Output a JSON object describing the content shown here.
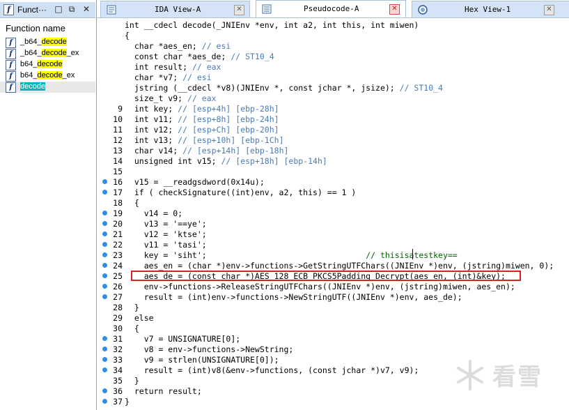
{
  "functions_pane": {
    "title": "Funct···",
    "header": "Function name",
    "items": [
      {
        "prefix": "_b64_",
        "match": "decode",
        "suffix": ""
      },
      {
        "prefix": "_b64_",
        "match": "decode",
        "suffix": "_ex"
      },
      {
        "prefix": "b64_",
        "match": "decode",
        "suffix": ""
      },
      {
        "prefix": "b64_",
        "match": "decode",
        "suffix": "_ex"
      },
      {
        "prefix": "",
        "match": "decode",
        "suffix": ""
      }
    ]
  },
  "tabs": [
    {
      "label": "IDA View-A",
      "icon": "ida-view-icon",
      "active": false
    },
    {
      "label": "Pseudocode-A",
      "icon": "pseudocode-icon",
      "active": true
    },
    {
      "label": "Hex View-1",
      "icon": "hex-view-icon",
      "active": false
    }
  ],
  "code_lines": [
    {
      "num": "",
      "dot": false,
      "text": "int __cdecl decode(_JNIEnv *env, int a2, int this, int miwen)"
    },
    {
      "num": "",
      "dot": false,
      "text": "{"
    },
    {
      "num": "",
      "dot": false,
      "text": "  char *aes_en; // esi"
    },
    {
      "num": "",
      "dot": false,
      "text": "  const char *aes_de; // ST10_4"
    },
    {
      "num": "",
      "dot": false,
      "text": "  int result; // eax"
    },
    {
      "num": "",
      "dot": false,
      "text": "  char *v7; // esi"
    },
    {
      "num": "",
      "dot": false,
      "text": "  jstring (__cdecl *v8)(JNIEnv *, const jchar *, jsize); // ST10_4"
    },
    {
      "num": "",
      "dot": false,
      "text": "  size_t v9; // eax"
    },
    {
      "num": "9",
      "dot": false,
      "text": "  int key; // [esp+4h] [ebp-28h]"
    },
    {
      "num": "10",
      "dot": false,
      "text": "  int v11; // [esp+8h] [ebp-24h]"
    },
    {
      "num": "11",
      "dot": false,
      "text": "  int v12; // [esp+Ch] [ebp-20h]"
    },
    {
      "num": "12",
      "dot": false,
      "text": "  int v13; // [esp+10h] [ebp-1Ch]"
    },
    {
      "num": "13",
      "dot": false,
      "text": "  char v14; // [esp+14h] [ebp-18h]"
    },
    {
      "num": "14",
      "dot": false,
      "text": "  unsigned int v15; // [esp+18h] [ebp-14h]"
    },
    {
      "num": "15",
      "dot": false,
      "text": ""
    },
    {
      "num": "16",
      "dot": true,
      "text": "  v15 = __readgsdword(0x14u);"
    },
    {
      "num": "17",
      "dot": true,
      "text": "  if ( checkSignature((int)env, a2, this) == 1 )"
    },
    {
      "num": "18",
      "dot": false,
      "text": "  {"
    },
    {
      "num": "19",
      "dot": true,
      "text": "    v14 = 0;"
    },
    {
      "num": "20",
      "dot": true,
      "text": "    v13 = '==ye';"
    },
    {
      "num": "21",
      "dot": true,
      "text": "    v12 = 'ktse';"
    },
    {
      "num": "22",
      "dot": true,
      "text": "    v11 = 'tasi';"
    },
    {
      "num": "23",
      "dot": true,
      "text": "    key = 'siht';                                 // thisisatestkey=="
    },
    {
      "num": "24",
      "dot": true,
      "text": "    aes_en = (char *)env->functions->GetStringUTFChars((JNIEnv *)env, (jstring)miwen, 0);"
    },
    {
      "num": "25",
      "dot": true,
      "text": "    aes_de = (const char *)AES_128_ECB_PKCS5Padding_Decrypt(aes_en, (int)&key);"
    },
    {
      "num": "26",
      "dot": true,
      "text": "    env->functions->ReleaseStringUTFChars((JNIEnv *)env, (jstring)miwen, aes_en);"
    },
    {
      "num": "27",
      "dot": true,
      "text": "    result = (int)env->functions->NewStringUTF((JNIEnv *)env, aes_de);"
    },
    {
      "num": "28",
      "dot": false,
      "text": "  }"
    },
    {
      "num": "29",
      "dot": false,
      "text": "  else"
    },
    {
      "num": "30",
      "dot": false,
      "text": "  {"
    },
    {
      "num": "31",
      "dot": true,
      "text": "    v7 = UNSIGNATURE[0];"
    },
    {
      "num": "32",
      "dot": true,
      "text": "    v8 = env->functions->NewString;"
    },
    {
      "num": "33",
      "dot": true,
      "text": "    v9 = strlen(UNSIGNATURE[0]);"
    },
    {
      "num": "34",
      "dot": true,
      "text": "    result = (int)v8(&env->functions, (const jchar *)v7, v9);"
    },
    {
      "num": "35",
      "dot": false,
      "text": "  }"
    },
    {
      "num": "36",
      "dot": true,
      "text": "  return result;"
    },
    {
      "num": "37",
      "dot": true,
      "text": "}"
    }
  ],
  "watermark": {
    "text": "看雪",
    "icon": "snowflake-icon"
  },
  "colors": {
    "accent_tab": "#d4e3f5",
    "highlight_yellow": "#ffff00",
    "highlight_cyan": "#17b3b3",
    "red_box": "#e02020",
    "dot_blue": "#2f8ee8"
  }
}
